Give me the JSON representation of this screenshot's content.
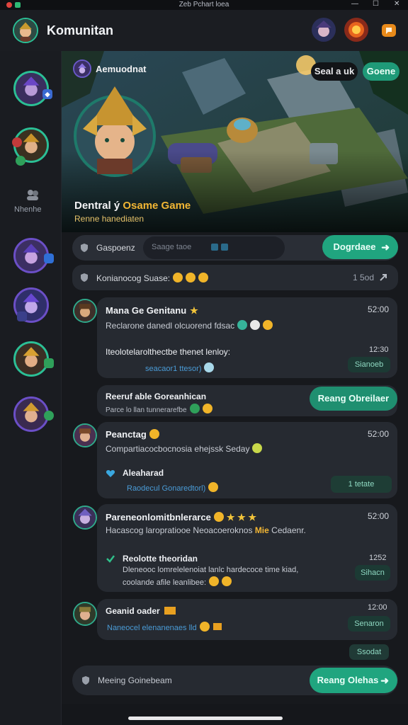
{
  "window": {
    "title": "Zeb Pchart loea",
    "controls": [
      "—",
      "☐",
      "✕"
    ]
  },
  "appbar": {
    "title": "Komunitan"
  },
  "sidebar": {
    "label": "Nhenhe"
  },
  "banner": {
    "channel_name": "Aemuodnat",
    "button_secondary": "Seal a uk",
    "button_primary": "Goene",
    "title_prefix": "Dentral ý ",
    "title_highlight": "Osame Game",
    "subtitle": "Renne hanediaten"
  },
  "tabs": {
    "active": "Gaspoenz",
    "inactive": "Saage taoe",
    "action": "Dogrdaee"
  },
  "section": {
    "label": "Konianocog Suase:",
    "count": "1 5od"
  },
  "posts": [
    {
      "author": "Mana Ge Genitanu",
      "time": "52:00",
      "text": "Reclarone danedl olcuorend fdsac",
      "reply": {
        "text": "Iteolotelarolthectbe thenet lenloy:",
        "sub": "seacaor1 ttesor)",
        "time": "12:30",
        "pill": "Sianoeb"
      }
    },
    {
      "author": "Reeruf able Goreanhican",
      "sub": "Parce lo llan tunnerarefbe",
      "button": "Reang Obreilaer"
    },
    {
      "author": "Peanctag",
      "time": "52:00",
      "text": "Compartiacocbocnosia ehejssk Seday",
      "reply": {
        "name": "Aleaharad",
        "sub": "Raodecul Gonaredtorl)",
        "pill": "1 tetate"
      }
    },
    {
      "author": "Pareneonlomitbnlerarce",
      "time": "52:00",
      "text": "Hacascog laropratiooe Neoacoeroknos",
      "text_highlight": "Mie",
      "text_tail": "Cedaenr.",
      "reply": {
        "name": "Reolotte theoridan",
        "body1": "Dleneooc lomrelelenoiat lanlc hardecoce time kiad,",
        "body2": "coolande afile leanlibee:",
        "time": "1252",
        "pill": "Sihacn"
      }
    },
    {
      "author": "Geanid oader",
      "time": "12:00",
      "text": "Naneocel elenanenaes lld",
      "pill": "Senaron"
    }
  ],
  "footer": {
    "pill": "Ssodat",
    "input_placeholder": "Meeing Goinebeam",
    "button": "Reang Olehas"
  }
}
